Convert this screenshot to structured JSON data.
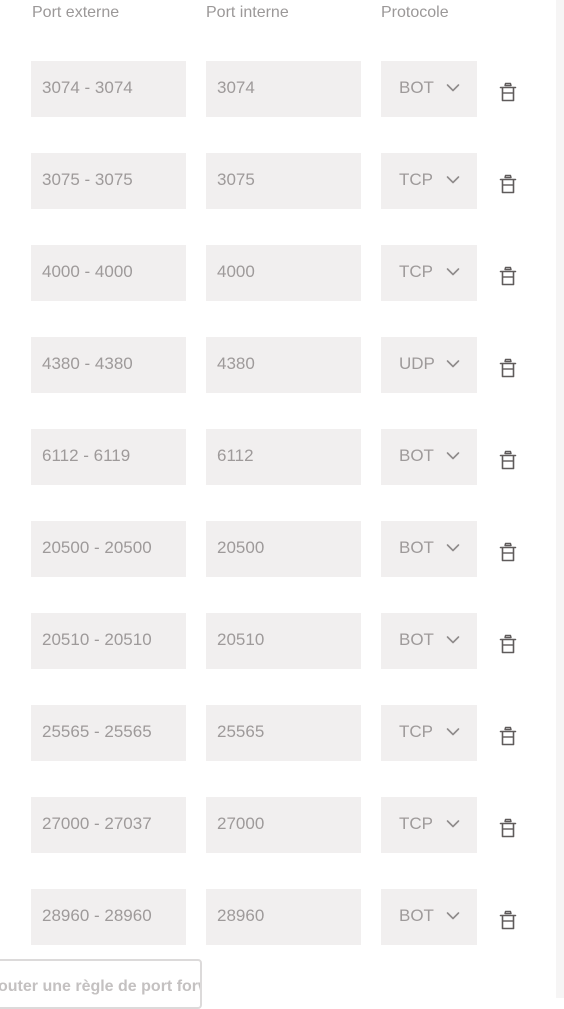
{
  "header": {
    "external_port": "Port externe",
    "internal_port": "Port interne",
    "protocol": "Protocole"
  },
  "rules": [
    {
      "external": "3074 - 3074",
      "internal": "3074",
      "protocol": "BOTH"
    },
    {
      "external": "3075 - 3075",
      "internal": "3075",
      "protocol": "TCP"
    },
    {
      "external": "4000 - 4000",
      "internal": "4000",
      "protocol": "TCP"
    },
    {
      "external": "4380 - 4380",
      "internal": "4380",
      "protocol": "UDP"
    },
    {
      "external": "6112 - 6119",
      "internal": "6112",
      "protocol": "BOTH"
    },
    {
      "external": "20500 - 20500",
      "internal": "20500",
      "protocol": "BOTH"
    },
    {
      "external": "20510 - 20510",
      "internal": "20510",
      "protocol": "BOTH"
    },
    {
      "external": "25565 - 25565",
      "internal": "25565",
      "protocol": "TCP"
    },
    {
      "external": "27000 - 27037",
      "internal": "27000",
      "protocol": "TCP"
    },
    {
      "external": "28960 - 28960",
      "internal": "28960",
      "protocol": "BOTH"
    }
  ],
  "footer": {
    "add_rule_label": "Ajouter une règle de port forwarding"
  },
  "icons": {
    "protocol_dropdown": "chevron-down-icon",
    "delete_rule": "trash-icon"
  },
  "colors": {
    "field_background": "#f1efef",
    "text": "#9e9a9a"
  }
}
